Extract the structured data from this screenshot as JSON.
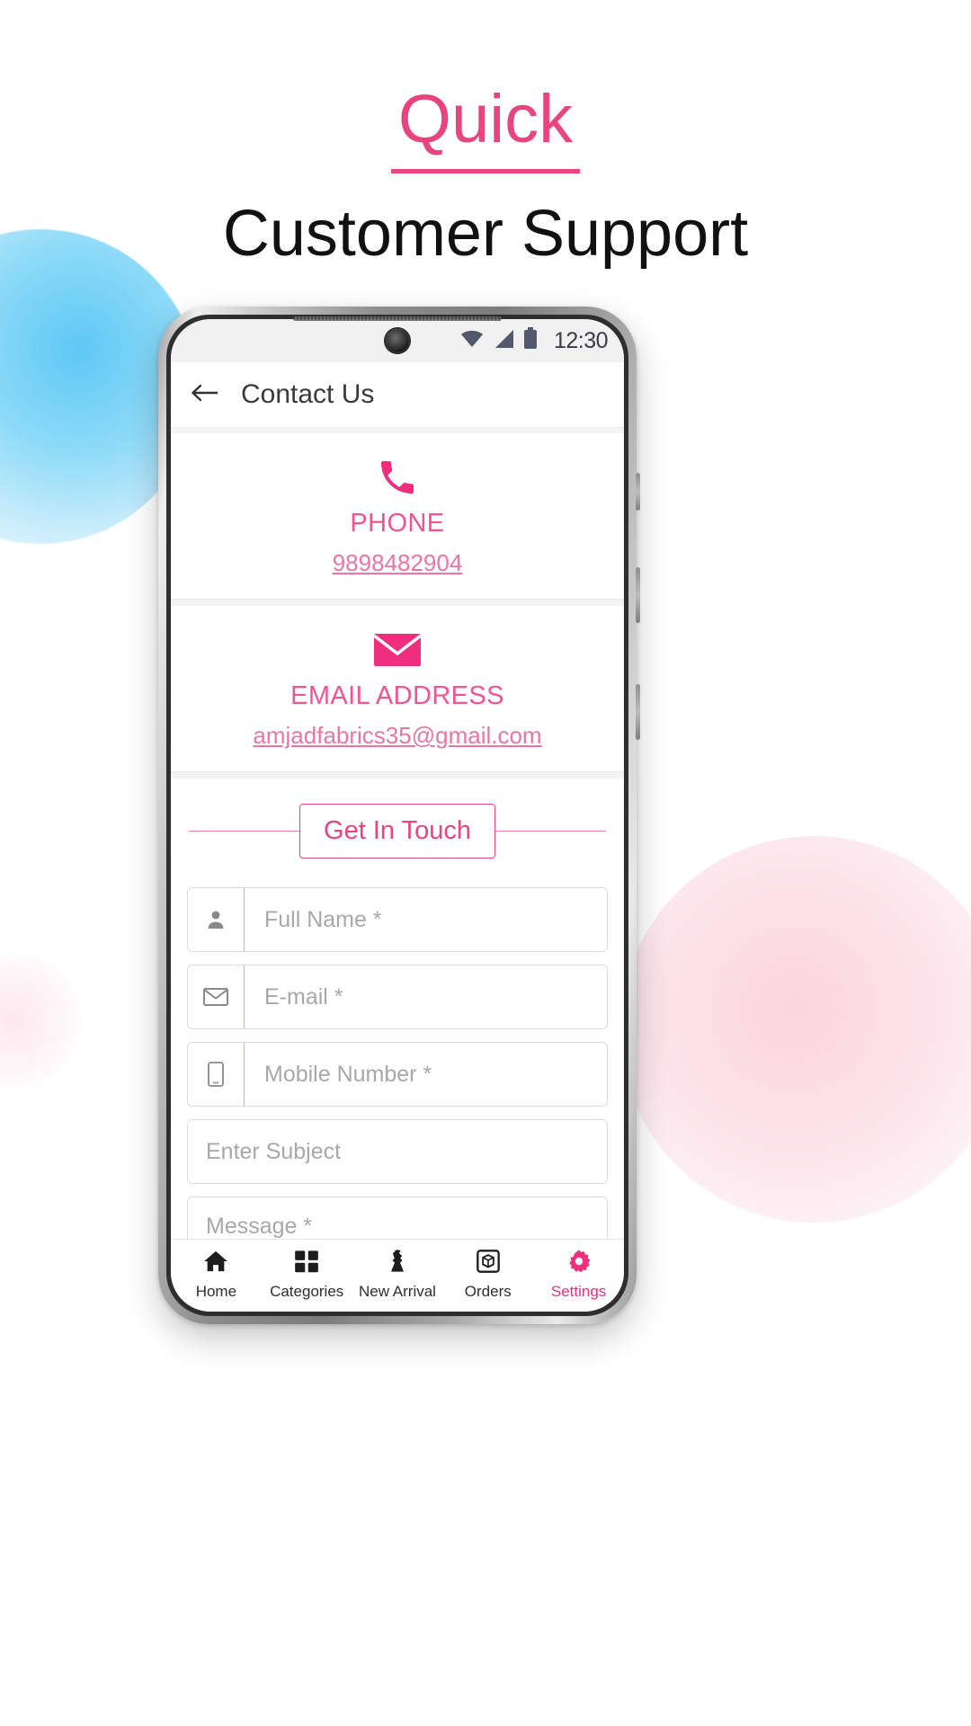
{
  "headline": {
    "line1": "Quick",
    "line2": "Customer Support",
    "accent_color": "#e8447d"
  },
  "phone": {
    "statusbar": {
      "time": "12:30",
      "icons": [
        "wifi-icon",
        "signal-icon",
        "battery-icon"
      ]
    },
    "appbar": {
      "back_icon": "back-arrow-icon",
      "title": "Contact Us"
    },
    "cards": [
      {
        "icon": "phone-icon",
        "title": "PHONE",
        "value": "9898482904"
      },
      {
        "icon": "email-icon",
        "title": "EMAIL ADDRESS",
        "value": "amjadfabrics35@gmail.com"
      }
    ],
    "get_in_touch": "Get In Touch",
    "form": {
      "fields": [
        {
          "icon": "person-icon",
          "placeholder": "Full Name *",
          "value": ""
        },
        {
          "icon": "envelope-icon",
          "placeholder": "E-mail *",
          "value": ""
        },
        {
          "icon": "mobile-icon",
          "placeholder": "Mobile Number *",
          "value": ""
        },
        {
          "icon": "",
          "placeholder": "Enter Subject",
          "value": ""
        },
        {
          "icon": "",
          "placeholder": "Message *",
          "value": ""
        }
      ]
    },
    "bottomnav": {
      "items": [
        {
          "icon": "home-icon",
          "label": "Home",
          "active": false
        },
        {
          "icon": "grid-icon",
          "label": "Categories",
          "active": false
        },
        {
          "icon": "dress-icon",
          "label": "New Arrival",
          "active": false
        },
        {
          "icon": "box-icon",
          "label": "Orders",
          "active": false
        },
        {
          "icon": "gear-icon",
          "label": "Settings",
          "active": true
        }
      ],
      "active_color": "#ef2f7d"
    }
  }
}
